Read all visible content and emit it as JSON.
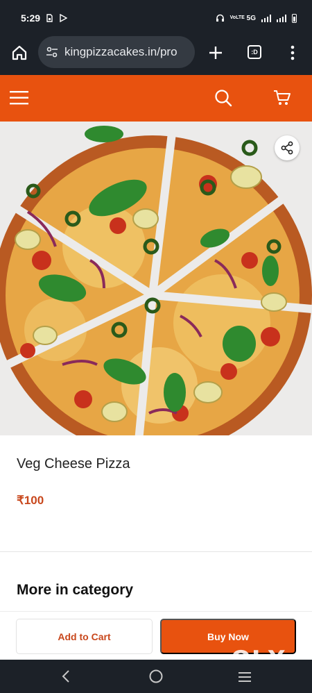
{
  "status": {
    "time": "5:29",
    "network": "5G",
    "volte": "VoLTE"
  },
  "browser": {
    "url": "kingpizzacakes.in/pro",
    "tab_count": ":D"
  },
  "product": {
    "name": "Veg Cheese Pizza",
    "price": "₹100"
  },
  "section": {
    "more_title": "More in category"
  },
  "actions": {
    "add_to_cart": "Add to Cart",
    "buy_now": "Buy Now"
  },
  "watermark": "OLX",
  "colors": {
    "brand": "#e8520f",
    "price": "#c8471c",
    "chrome": "#1c2128"
  },
  "icons": [
    "menu-icon",
    "search-icon",
    "cart-icon",
    "share-icon",
    "home-icon",
    "add-tab-icon",
    "more-options-icon",
    "back-nav-icon",
    "home-nav-icon",
    "recents-nav-icon"
  ]
}
